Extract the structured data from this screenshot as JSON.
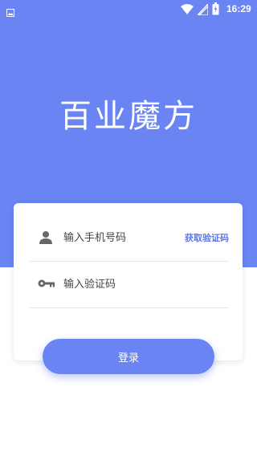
{
  "status_bar": {
    "time": "16:29",
    "icons": [
      "gallery-icon",
      "wifi-icon",
      "signal-icon",
      "battery-charging-icon"
    ]
  },
  "brand": {
    "title": "百业魔方"
  },
  "login_form": {
    "phone_placeholder": "输入手机号码",
    "code_placeholder": "输入验证码",
    "get_code_label": "获取验证码",
    "phone_icon": "user-icon",
    "code_icon": "key-icon"
  },
  "login_button": {
    "label": "登录"
  },
  "colors": {
    "primary": "#6a84f3",
    "link": "#5f78e8",
    "background": "#ffffff"
  }
}
